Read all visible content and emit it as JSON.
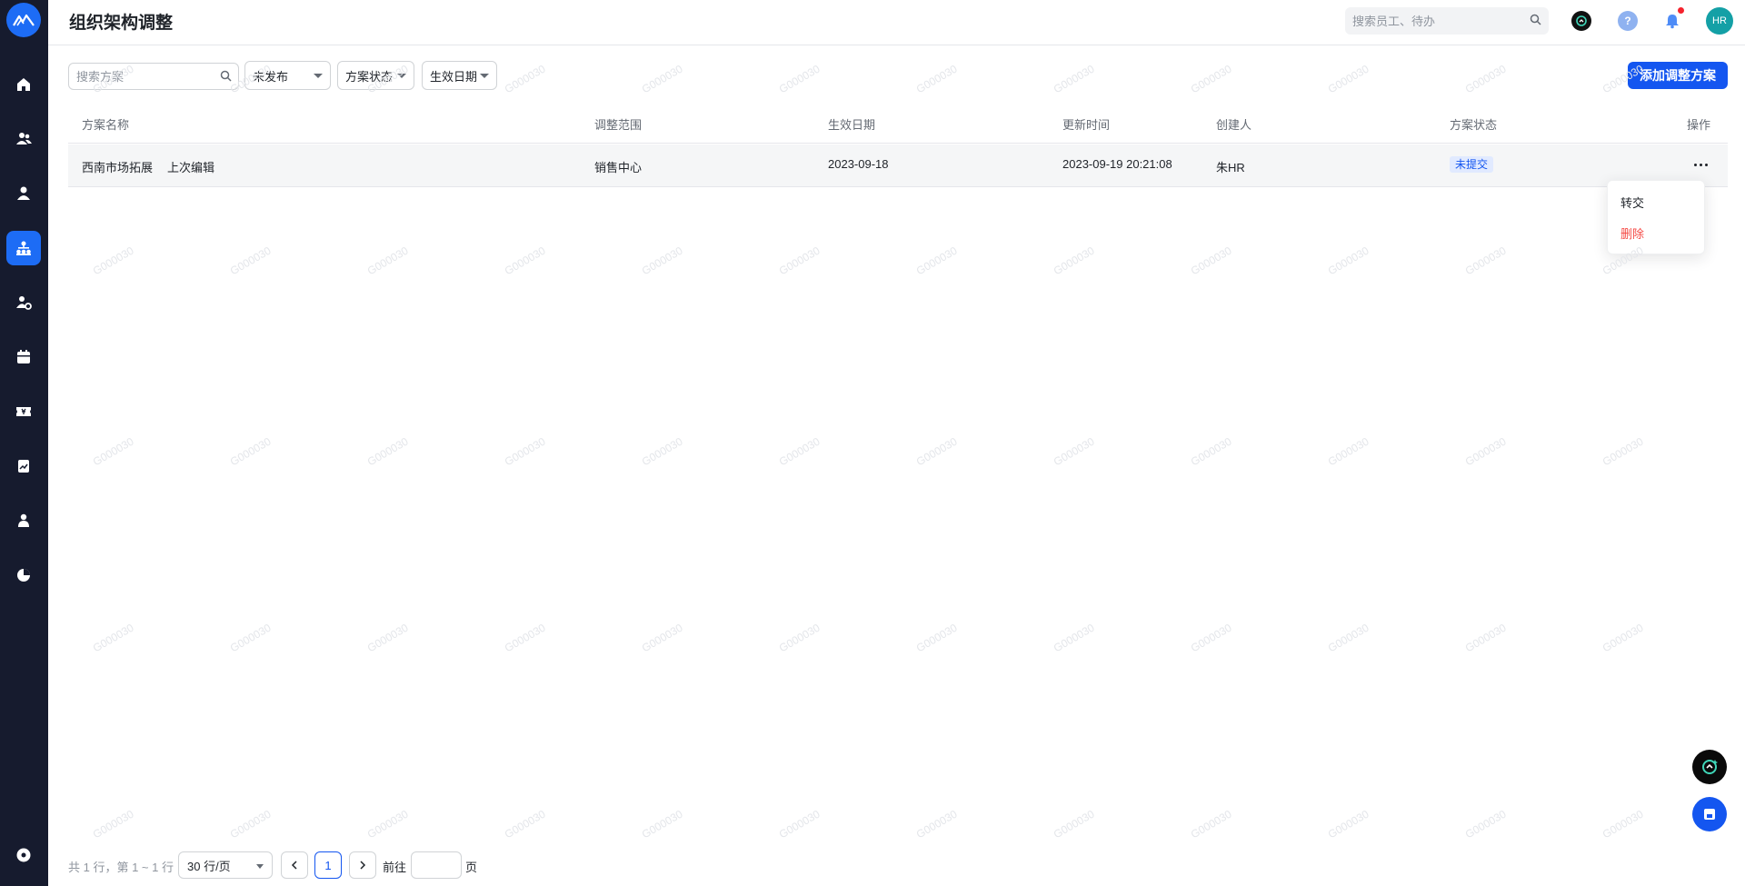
{
  "header": {
    "title": "组织架构调整",
    "search_placeholder": "搜索员工、待办",
    "avatar_text": "HR",
    "help_glyph": "?"
  },
  "sidebar": {
    "items": [
      {
        "icon": "home-icon"
      },
      {
        "icon": "people-icon"
      },
      {
        "icon": "person-icon"
      },
      {
        "icon": "org-chart-icon",
        "active": true
      },
      {
        "icon": "user-settings-icon"
      },
      {
        "icon": "calendar-icon"
      },
      {
        "icon": "ticket-icon"
      },
      {
        "icon": "report-icon"
      },
      {
        "icon": "profile-icon"
      },
      {
        "icon": "pie-chart-icon"
      },
      {
        "icon": "settings-icon"
      }
    ]
  },
  "toolbar": {
    "search_placeholder": "搜索方案",
    "filter_publish": "未发布",
    "filter_status": "方案状态",
    "filter_date": "生效日期",
    "add_button": "添加调整方案"
  },
  "table": {
    "columns": [
      "方案名称",
      "调整范围",
      "生效日期",
      "更新时间",
      "创建人",
      "方案状态",
      "操作"
    ],
    "rows": [
      {
        "name": "西南市场拓展",
        "edit_link": "上次编辑",
        "scope": "销售中心",
        "effective_date": "2023-09-18",
        "updated_at": "2023-09-19 20:21:08",
        "creator": "朱HR",
        "status": "未提交"
      }
    ]
  },
  "row_menu": {
    "transfer": "转交",
    "delete": "删除"
  },
  "pagination": {
    "summary": "共 1 行，第 1 ~ 1 行",
    "page_size": "30 行/页",
    "current_page": "1",
    "goto_label": "前往",
    "page_label": "页"
  },
  "watermark": "G000030",
  "colors": {
    "primary": "#1456f0",
    "sidebar_bg": "#161b2e",
    "danger": "#f54a45",
    "avatar": "#14a0a6"
  }
}
